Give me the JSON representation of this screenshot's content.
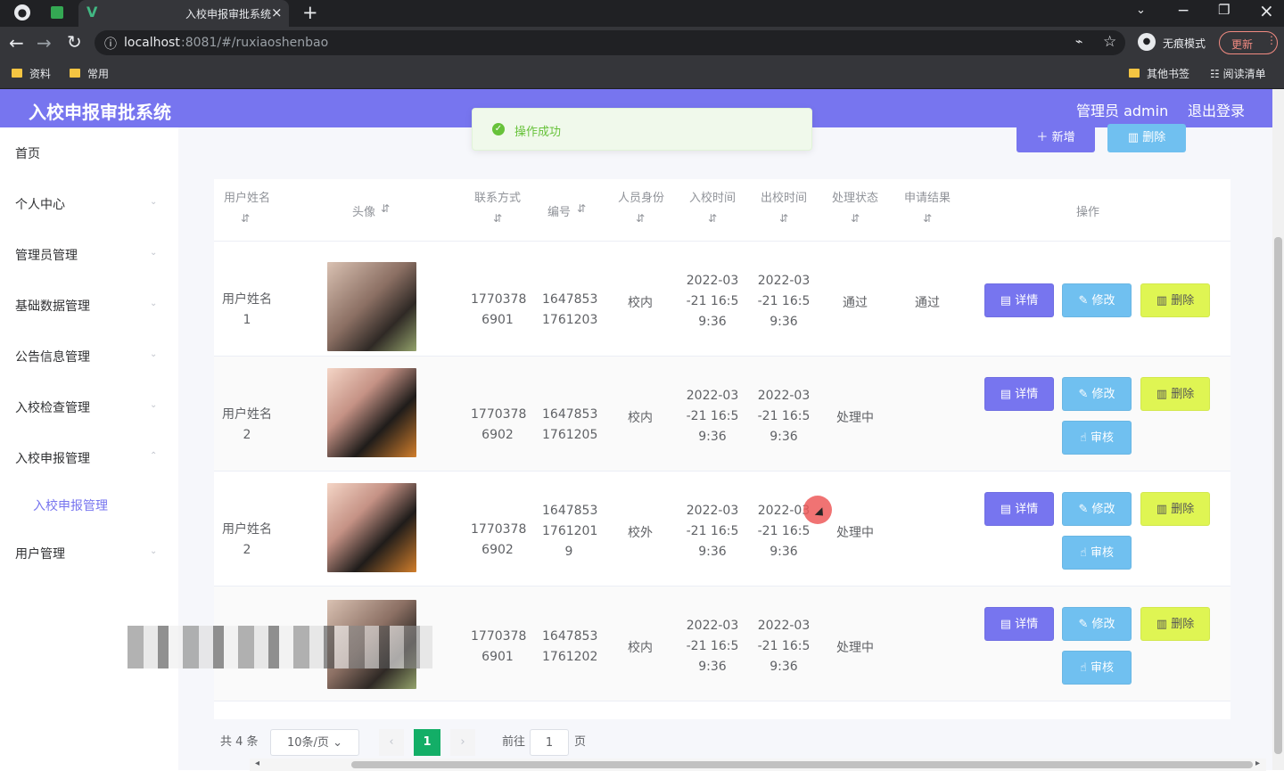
{
  "browser": {
    "tab_title": "入校申报审批系统",
    "address": "localhost:8081/#/ruxiaoshenbao",
    "host": "localhost",
    "path": ":8081/#/ruxiaoshenbao",
    "incognito": "无痕模式",
    "update": "更新",
    "bookmarks": [
      "资料",
      "常用"
    ],
    "other_bookmarks": "其他书签",
    "reading_list": "阅读清单"
  },
  "app": {
    "title": "入校申报审批系统",
    "admin": "管理员 admin",
    "logout": "退出登录",
    "toast": "操作成功",
    "add": "新增",
    "delete": "删除"
  },
  "sidebar": {
    "items": [
      "首页",
      "个人中心",
      "管理员管理",
      "基础数据管理",
      "公告信息管理",
      "入校检查管理",
      "入校申报管理",
      "用户管理"
    ],
    "subitem": "入校申报管理"
  },
  "table": {
    "headers": [
      "用户姓名",
      "头像",
      "联系方式",
      "编号",
      "人员身份",
      "入校时间",
      "出校时间",
      "处理状态",
      "申请结果",
      "操作"
    ],
    "rows": [
      {
        "name": "用户姓名 1",
        "phone": "1770378 6901",
        "code": "1647853 1761203",
        "role": "校内",
        "in": "2022-03 -21 16:5 9:36",
        "out": "2022-03 -21 16:5 9:36",
        "status": "通过",
        "result": "通过",
        "actions": [
          "详情",
          "修改",
          "删除"
        ]
      },
      {
        "name": "用户姓名 2",
        "phone": "1770378 6902",
        "code": "1647853 1761205",
        "role": "校内",
        "in": "2022-03 -21 16:5 9:36",
        "out": "2022-03 -21 16:5 9:36",
        "status": "处理中",
        "result": "",
        "actions": [
          "详情",
          "修改",
          "删除",
          "审核"
        ]
      },
      {
        "name": "用户姓名 2",
        "phone": "1770378 6902",
        "code": "1647853 1761201 9",
        "role": "校外",
        "in": "2022-03 -21 16:5 9:36",
        "out": "2022-03 -21 16:5 9:36",
        "status": "处理中",
        "result": "",
        "actions": [
          "详情",
          "修改",
          "删除",
          "审核"
        ]
      },
      {
        "name": "",
        "phone": "1770378 6901",
        "code": "1647853 1761202",
        "role": "校内",
        "in": "2022-03 -21 16:5 9:36",
        "out": "2022-03 -21 16:5 9:36",
        "status": "处理中",
        "result": "",
        "actions": [
          "详情",
          "修改",
          "删除",
          "审核"
        ]
      }
    ]
  },
  "pagination": {
    "total": "共 4 条",
    "page_size": "10条/页",
    "current": "1",
    "goto": "前往",
    "page_input": "1",
    "page_unit": "页"
  },
  "colors": {
    "accent": "#7775ef",
    "success": "#67c23a",
    "blue": "#70c0f0",
    "yellow": "#dff553"
  }
}
